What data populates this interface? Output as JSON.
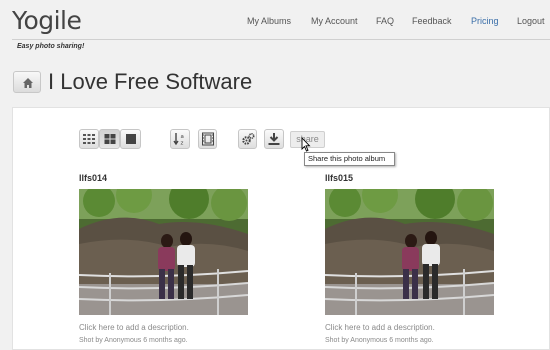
{
  "header": {
    "logo": "Yogile",
    "tagline": "Easy photo sharing!",
    "nav": [
      "My Albums",
      "My Account",
      "FAQ",
      "Feedback",
      "Pricing",
      "Logout"
    ]
  },
  "page": {
    "title": "I Love Free Software"
  },
  "toolbar": {
    "share_label": "share",
    "share_tooltip": "Share this photo album"
  },
  "albums": [
    {
      "name": "llfs014",
      "description": "Click here to add a description.",
      "credit": "Shot by Anonymous 6 months ago."
    },
    {
      "name": "llfs015",
      "description": "Click here to add a description.",
      "credit": "Shot by Anonymous 6 months ago."
    }
  ],
  "colors": {
    "accent": "#3a6ea8"
  }
}
